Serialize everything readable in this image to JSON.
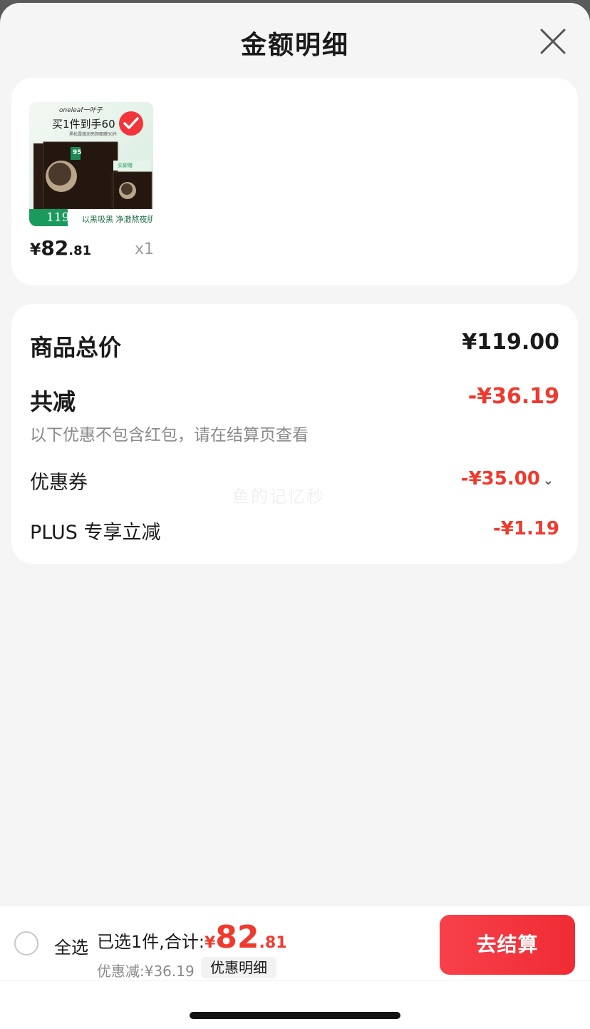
{
  "header": {
    "title": "金额明细"
  },
  "product": {
    "image": {
      "brand": "oneleaf一叶子",
      "headline": "买1件到手60",
      "subline": "黑松露蕴润亮颜面膜30片",
      "badge_num": "95",
      "price_tag": "119",
      "slogan": "以黑吸黑 净澈熬夜肌",
      "gift_text": "买即赠"
    },
    "price_symbol": "¥",
    "price_int": "82",
    "price_dec": ".81",
    "qty": "x1"
  },
  "breakdown": {
    "total_label": "商品总价",
    "total_value": "¥119.00",
    "reduce_label": "共减",
    "reduce_value": "-¥36.19",
    "note": "以下优惠不包含红包，请在结算页查看",
    "coupon_label": "优惠券",
    "coupon_value": "-¥35.00",
    "plus_label": "PLUS 专享立减",
    "plus_value": "-¥1.19"
  },
  "watermark": "鱼的记忆秒",
  "footer": {
    "select_all": "全选",
    "selected_text": "已选1件,合计:",
    "total_symbol": "¥",
    "total_int": "82",
    "total_dec": ".81",
    "discount_text": "优惠减:¥36.19",
    "detail_button": "优惠明细",
    "checkout_button": "去结算"
  },
  "colors": {
    "accent": "#f03a2e",
    "checkout": "#f02b34",
    "brand_green": "#1a9a5c"
  },
  "icons": [
    "close-icon",
    "check-icon",
    "chevron-down-icon",
    "radio-unchecked-icon"
  ]
}
